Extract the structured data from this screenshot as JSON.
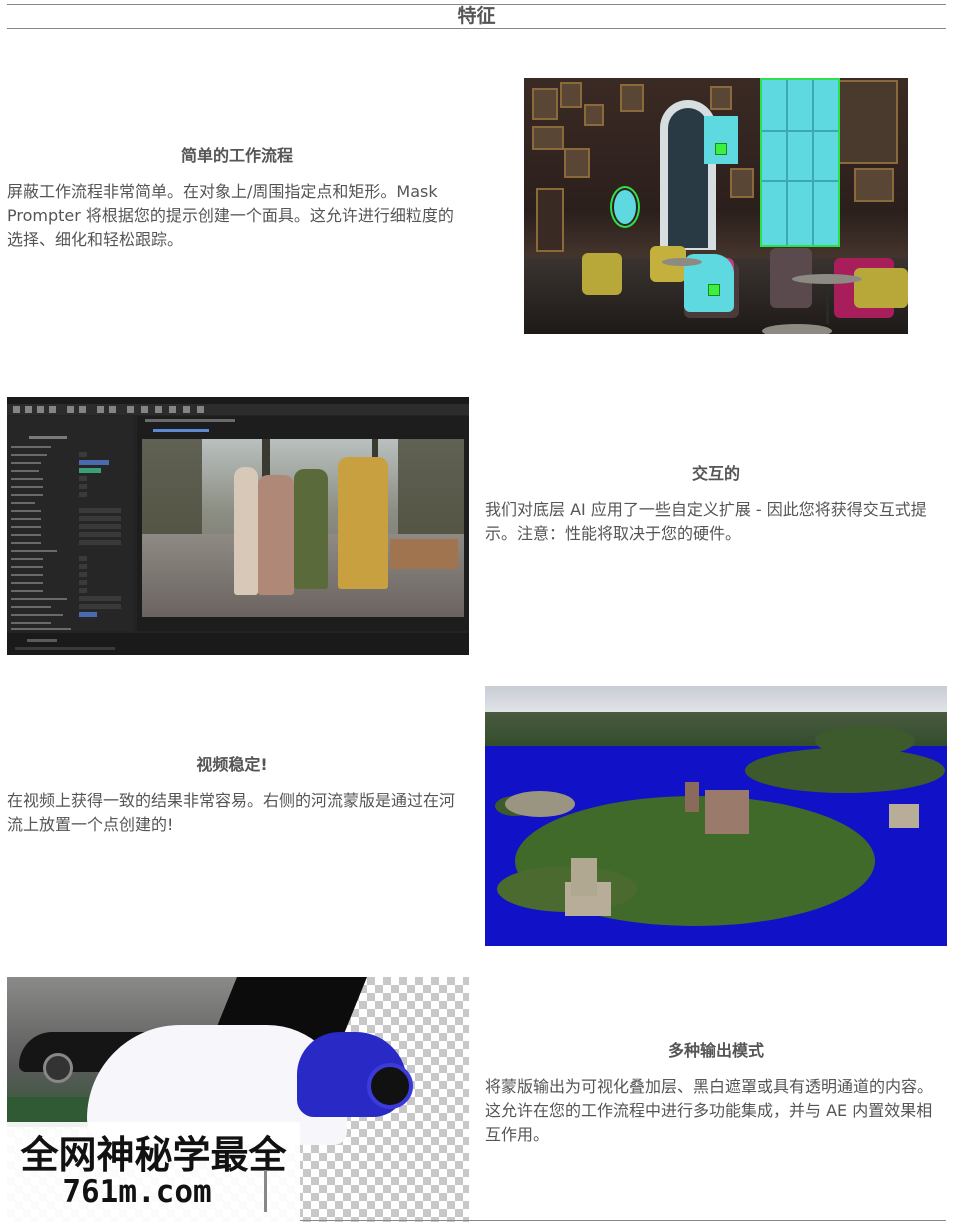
{
  "page": {
    "title": "特征"
  },
  "features": [
    {
      "heading": "简单的工作流程",
      "text": "屏蔽工作流程非常简单。在对象上/周围指定点和矩形。Mask Prompter 将根据您的提示创建一个面具。这允许进行细粒度的选择、细化和轻松跟踪。"
    },
    {
      "heading": "交互的",
      "text": "我们对底层 AI 应用了一些自定义扩展 - 因此您将获得交互式提示。注意：性能将取决于您的硬件。"
    },
    {
      "heading": "视频稳定!",
      "text": "在视频上获得一致的结果非常容易。右侧的河流蒙版是通过在河流上放置一个点创建的!"
    },
    {
      "heading": "多种输出模式",
      "text": "将蒙版输出为可视化叠加层、黑白遮罩或具有透明通道的内容。这允许在您的工作流程中进行多功能集成，并与 AE 内置效果相互作用。"
    }
  ],
  "watermark": {
    "line1": "全网神秘学最全",
    "line2": "761m.com"
  },
  "colors": {
    "mask_cyan": "#5fd9e0",
    "mask_green": "#2ee04a",
    "mask_blue": "#1111c8"
  }
}
